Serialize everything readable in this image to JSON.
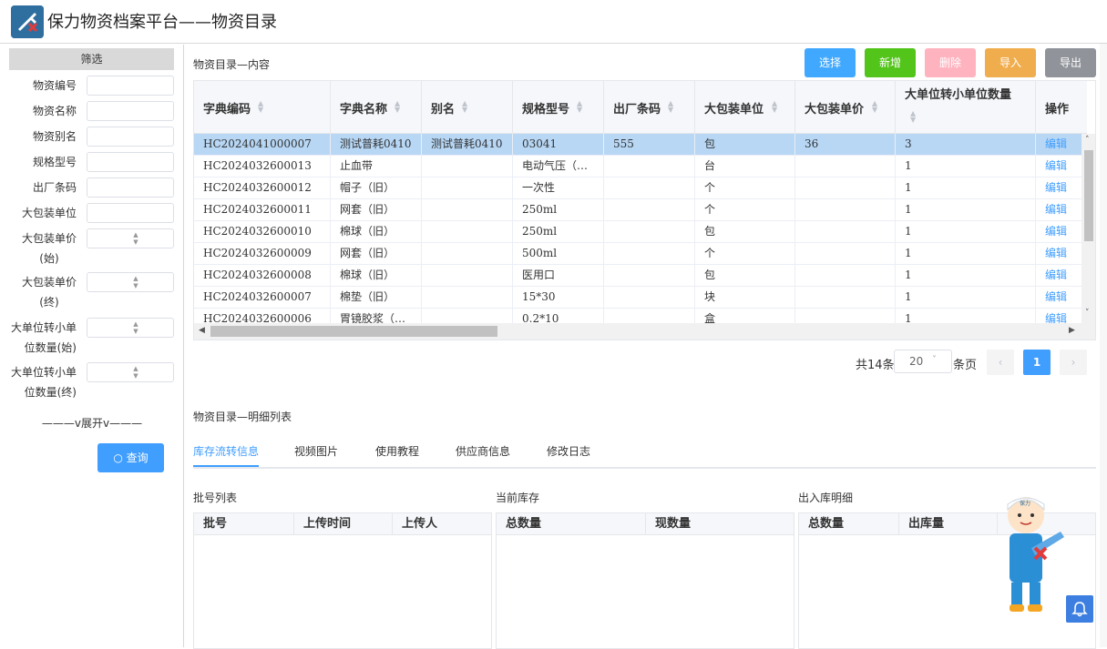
{
  "app": {
    "title": "保力物资档案平台——物资目录"
  },
  "sidebar": {
    "header": "筛选",
    "fields": [
      {
        "label": "物资编号"
      },
      {
        "label": "物资名称"
      },
      {
        "label": "物资别名"
      },
      {
        "label": "规格型号"
      },
      {
        "label": "出厂条码"
      },
      {
        "label": "大包装单位"
      }
    ],
    "range_fields": [
      {
        "line1": "大包装单价",
        "line2": "(始)"
      },
      {
        "line1": "大包装单价",
        "line2": "(终)"
      },
      {
        "line1": "大单位转小单",
        "line2": "位数量(始)"
      },
      {
        "line1": "大单位转小单",
        "line2": "位数量(终)"
      }
    ],
    "expand": "———v展开v———",
    "query_label": "查询"
  },
  "section1": {
    "title": "物资目录—内容"
  },
  "toolbar": {
    "select_label": "选择",
    "add_label": "新增",
    "delete_label": "删除",
    "import_label": "导入",
    "export_label": "导出"
  },
  "table": {
    "headers": [
      "字典编码",
      "字典名称",
      "别名",
      "规格型号",
      "出厂条码",
      "大包装单位",
      "大包装单价",
      "大单位转小单位数量",
      "操作"
    ],
    "edit_label": "编辑",
    "rows": [
      [
        "HC2024041000007",
        "测试普耗0410",
        "测试普耗0410",
        "03041",
        "555",
        "包",
        "36",
        "3"
      ],
      [
        "HC2024032600013",
        "止血带",
        "",
        "电动气压（…",
        "",
        "台",
        "",
        "1"
      ],
      [
        "HC2024032600012",
        "帽子（旧）",
        "",
        "一次性",
        "",
        "个",
        "",
        "1"
      ],
      [
        "HC2024032600011",
        "网套（旧）",
        "",
        "250ml",
        "",
        "个",
        "",
        "1"
      ],
      [
        "HC2024032600010",
        "棉球（旧）",
        "",
        "250ml",
        "",
        "包",
        "",
        "1"
      ],
      [
        "HC2024032600009",
        "网套（旧）",
        "",
        "500ml",
        "",
        "个",
        "",
        "1"
      ],
      [
        "HC2024032600008",
        "棉球（旧）",
        "",
        "医用口",
        "",
        "包",
        "",
        "1"
      ],
      [
        "HC2024032600007",
        "棉垫（旧）",
        "",
        "15*30",
        "",
        "块",
        "",
        "1"
      ],
      [
        "HC2024032600006",
        "胃镜胶浆（…",
        "",
        "0.2*10",
        "",
        "盒",
        "",
        "1"
      ]
    ]
  },
  "pagination": {
    "total": "共14条",
    "page_size": "20",
    "per_page": "条页",
    "current": "1"
  },
  "section2": {
    "title": "物资目录—明细列表"
  },
  "tabs": [
    "库存流转信息",
    "视频图片",
    "使用教程",
    "供应商信息",
    "修改日志"
  ],
  "sub_tables": [
    {
      "title": "批号列表",
      "headers": [
        "批号",
        "上传时间",
        "上传人"
      ]
    },
    {
      "title": "当前库存",
      "headers": [
        "总数量",
        "现数量"
      ]
    },
    {
      "title": "出入库明细",
      "headers": [
        "总数量",
        "出库量"
      ]
    }
  ],
  "mascot": {
    "label": "保力"
  },
  "colors": {
    "primary": "#409eff",
    "success": "#52c41a",
    "danger_disabled": "#ffb3bf",
    "warning": "#f0ad4e",
    "info": "#909399"
  }
}
